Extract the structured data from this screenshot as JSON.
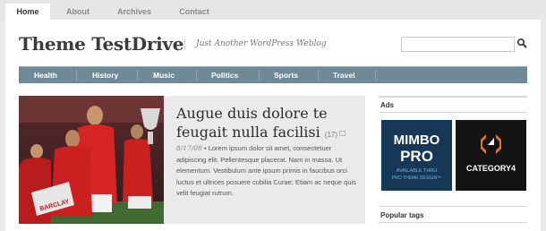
{
  "top_nav": {
    "tabs": [
      {
        "label": "Home",
        "active": true
      },
      {
        "label": "About",
        "active": false
      },
      {
        "label": "Archives",
        "active": false
      },
      {
        "label": "Contact",
        "active": false
      }
    ]
  },
  "header": {
    "site_title": "Theme TestDrive",
    "tagline": "Just Another WordPress Weblog",
    "search_value": ""
  },
  "categories": [
    "Health",
    "History",
    "Music",
    "Politics",
    "Sports",
    "Travel"
  ],
  "featured_post": {
    "title": "Augue duis dolore te feugait nulla facilisi",
    "comment_count": "(17)",
    "date": "8/17/08",
    "separator": " • ",
    "excerpt": "Lorem ipsum dolor sit amet, consectetuer adipiscing elit. Pellentesque placerat. Nam in massa. Ut elementum. Vestibulum ante ipsum primis in faucibus orci luctus et ultrices posuere cubilia Curae; Etiam ac neque quis velit feugiat rutrum.",
    "photo_banner_text": "BARCLAY"
  },
  "sidebar": {
    "ads_heading": "Ads",
    "ad1": {
      "line1": "MIMBO",
      "line2": "PRO",
      "line3": "AVAILABLE THRU",
      "line4": "PRO THEME DESIGN™"
    },
    "ad2": {
      "name": "CATEGORY4"
    },
    "tags_heading": "Popular tags"
  },
  "colors": {
    "category_bar": "#6e8a97",
    "page_background": "#e9e9e9",
    "feature_background": "#eaeaea",
    "ad1_background": "#1c3a5c",
    "ad2_background": "#141414",
    "ad2_accent": "#e8712a"
  }
}
